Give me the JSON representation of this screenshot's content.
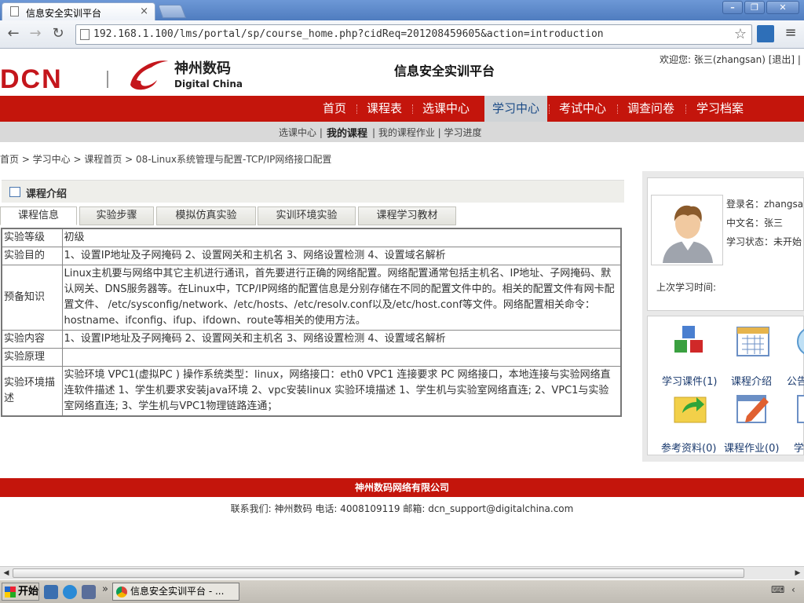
{
  "browser": {
    "tab_title": "信息安全实训平台",
    "tab_close": "×",
    "url": "192.168.1.100/lms/portal/sp/course_home.php?cidReq=201208459605&action=introduction",
    "win_min": "–",
    "win_max": "❐",
    "win_close": "✕"
  },
  "header": {
    "logo_text": "DCN",
    "logo_cn": "神州数码",
    "logo_en": "Digital China",
    "site_title": "信息安全实训平台",
    "welcome": "欢迎您: 张三(zhangsan) [退出] |"
  },
  "nav": {
    "items": [
      {
        "label": "首页"
      },
      {
        "label": "课程表"
      },
      {
        "label": "选课中心"
      },
      {
        "label": "学习中心"
      },
      {
        "label": "考试中心"
      },
      {
        "label": "调查问卷"
      },
      {
        "label": "学习档案"
      }
    ],
    "active_index": 3
  },
  "subnav": {
    "items": [
      {
        "label": "选课中心 |"
      },
      {
        "label": "我的课程"
      },
      {
        "label": "| 我的课程作业 | 学习进度"
      }
    ]
  },
  "breadcrumb": "首页 > 学习中心 > 课程首页 > 08-Linux系统管理与配置-TCP/IP网络接口配置",
  "section": {
    "title": "课程介绍"
  },
  "content_tabs": [
    {
      "label": "课程信息"
    },
    {
      "label": "实验步骤"
    },
    {
      "label": "模拟仿真实验"
    },
    {
      "label": "实训环境实验"
    },
    {
      "label": "课程学习教材"
    }
  ],
  "table": {
    "rows": [
      {
        "label": "实验等级",
        "value": "初级"
      },
      {
        "label": "实验目的",
        "value": "1、设置IP地址及子网掩码 2、设置网关和主机名 3、网络设置检测 4、设置域名解析"
      },
      {
        "label": "预备知识",
        "value": "Linux主机要与网络中其它主机进行通讯，首先要进行正确的网络配置。网络配置通常包括主机名、IP地址、子网掩码、默认网关、DNS服务器等。在Linux中，TCP/IP网络的配置信息是分别存储在不同的配置文件中的。相关的配置文件有网卡配置文件、 /etc/sysconfig/network、/etc/hosts、/etc/resolv.conf以及/etc/host.conf等文件。网络配置相关命令：hostname、ifconfig、ifup、ifdown、route等相关的使用方法。"
      },
      {
        "label": "实验内容",
        "value": "1、设置IP地址及子网掩码 2、设置网关和主机名 3、网络设置检测 4、设置域名解析"
      },
      {
        "label": "实验原理",
        "value": ""
      },
      {
        "label": "实验环境描述",
        "value": "实验环境 VPC1(虚拟PC ) 操作系统类型：linux，网络接口：eth0 VPC1 连接要求 PC 网络接口，本地连接与实验网络直连软件描述 1、学生机要求安装java环境 2、vpc安装linux 实验环境描述 1、学生机与实验室网络直连; 2、VPC1与实验室网络直连; 3、学生机与VPC1物理链路连通；"
      }
    ]
  },
  "user_info": {
    "login_name": "登录名：zhangsan",
    "cn_name": "中文名：张三",
    "study_status": "学习状态：未开始",
    "last_study": "上次学习时间:"
  },
  "functions": [
    {
      "label": "学习课件(1)",
      "icon": "cubes-icon"
    },
    {
      "label": "课程介绍",
      "icon": "calendar-icon"
    },
    {
      "label": "公告",
      "icon": "globe-icon"
    },
    {
      "label": "参考资料(0)",
      "icon": "folder-arrow-icon"
    },
    {
      "label": "课程作业(0)",
      "icon": "pencil-doc-icon"
    },
    {
      "label": "学",
      "icon": "doc-icon"
    }
  ],
  "footer": {
    "company": "神州数码网络有限公司",
    "contact": "联系我们: 神州数码 电话: 4008109119 邮箱: dcn_support@digitalchina.com"
  },
  "taskbar": {
    "start": "开始",
    "task_title": "信息安全实训平台 - ...",
    "more": "»",
    "tray_chevron": "‹"
  },
  "colors": {
    "brand_red": "#c4150c",
    "nav_active_text": "#1a4a86",
    "function_link": "#1a3a6e"
  }
}
